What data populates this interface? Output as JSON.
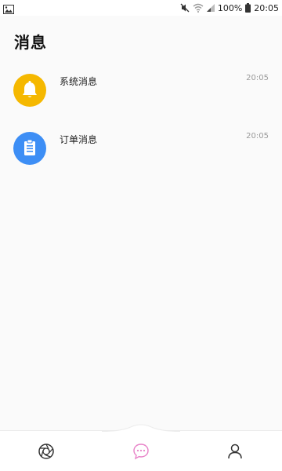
{
  "status_bar": {
    "battery_percent": "100%",
    "time": "20:05"
  },
  "header": {
    "title": "消息"
  },
  "messages": [
    {
      "title": "系统消息",
      "time": "20:05",
      "icon": "bell-icon",
      "color": "#f5b800"
    },
    {
      "title": "订单消息",
      "time": "20:05",
      "icon": "clipboard-icon",
      "color": "#3d8ef5"
    }
  ],
  "tab_bar": {
    "tabs": [
      {
        "icon": "aperture-icon",
        "active": false
      },
      {
        "icon": "chat-bubble-icon",
        "active": true
      },
      {
        "icon": "user-icon",
        "active": false
      }
    ],
    "active_color": "#e882c8"
  }
}
